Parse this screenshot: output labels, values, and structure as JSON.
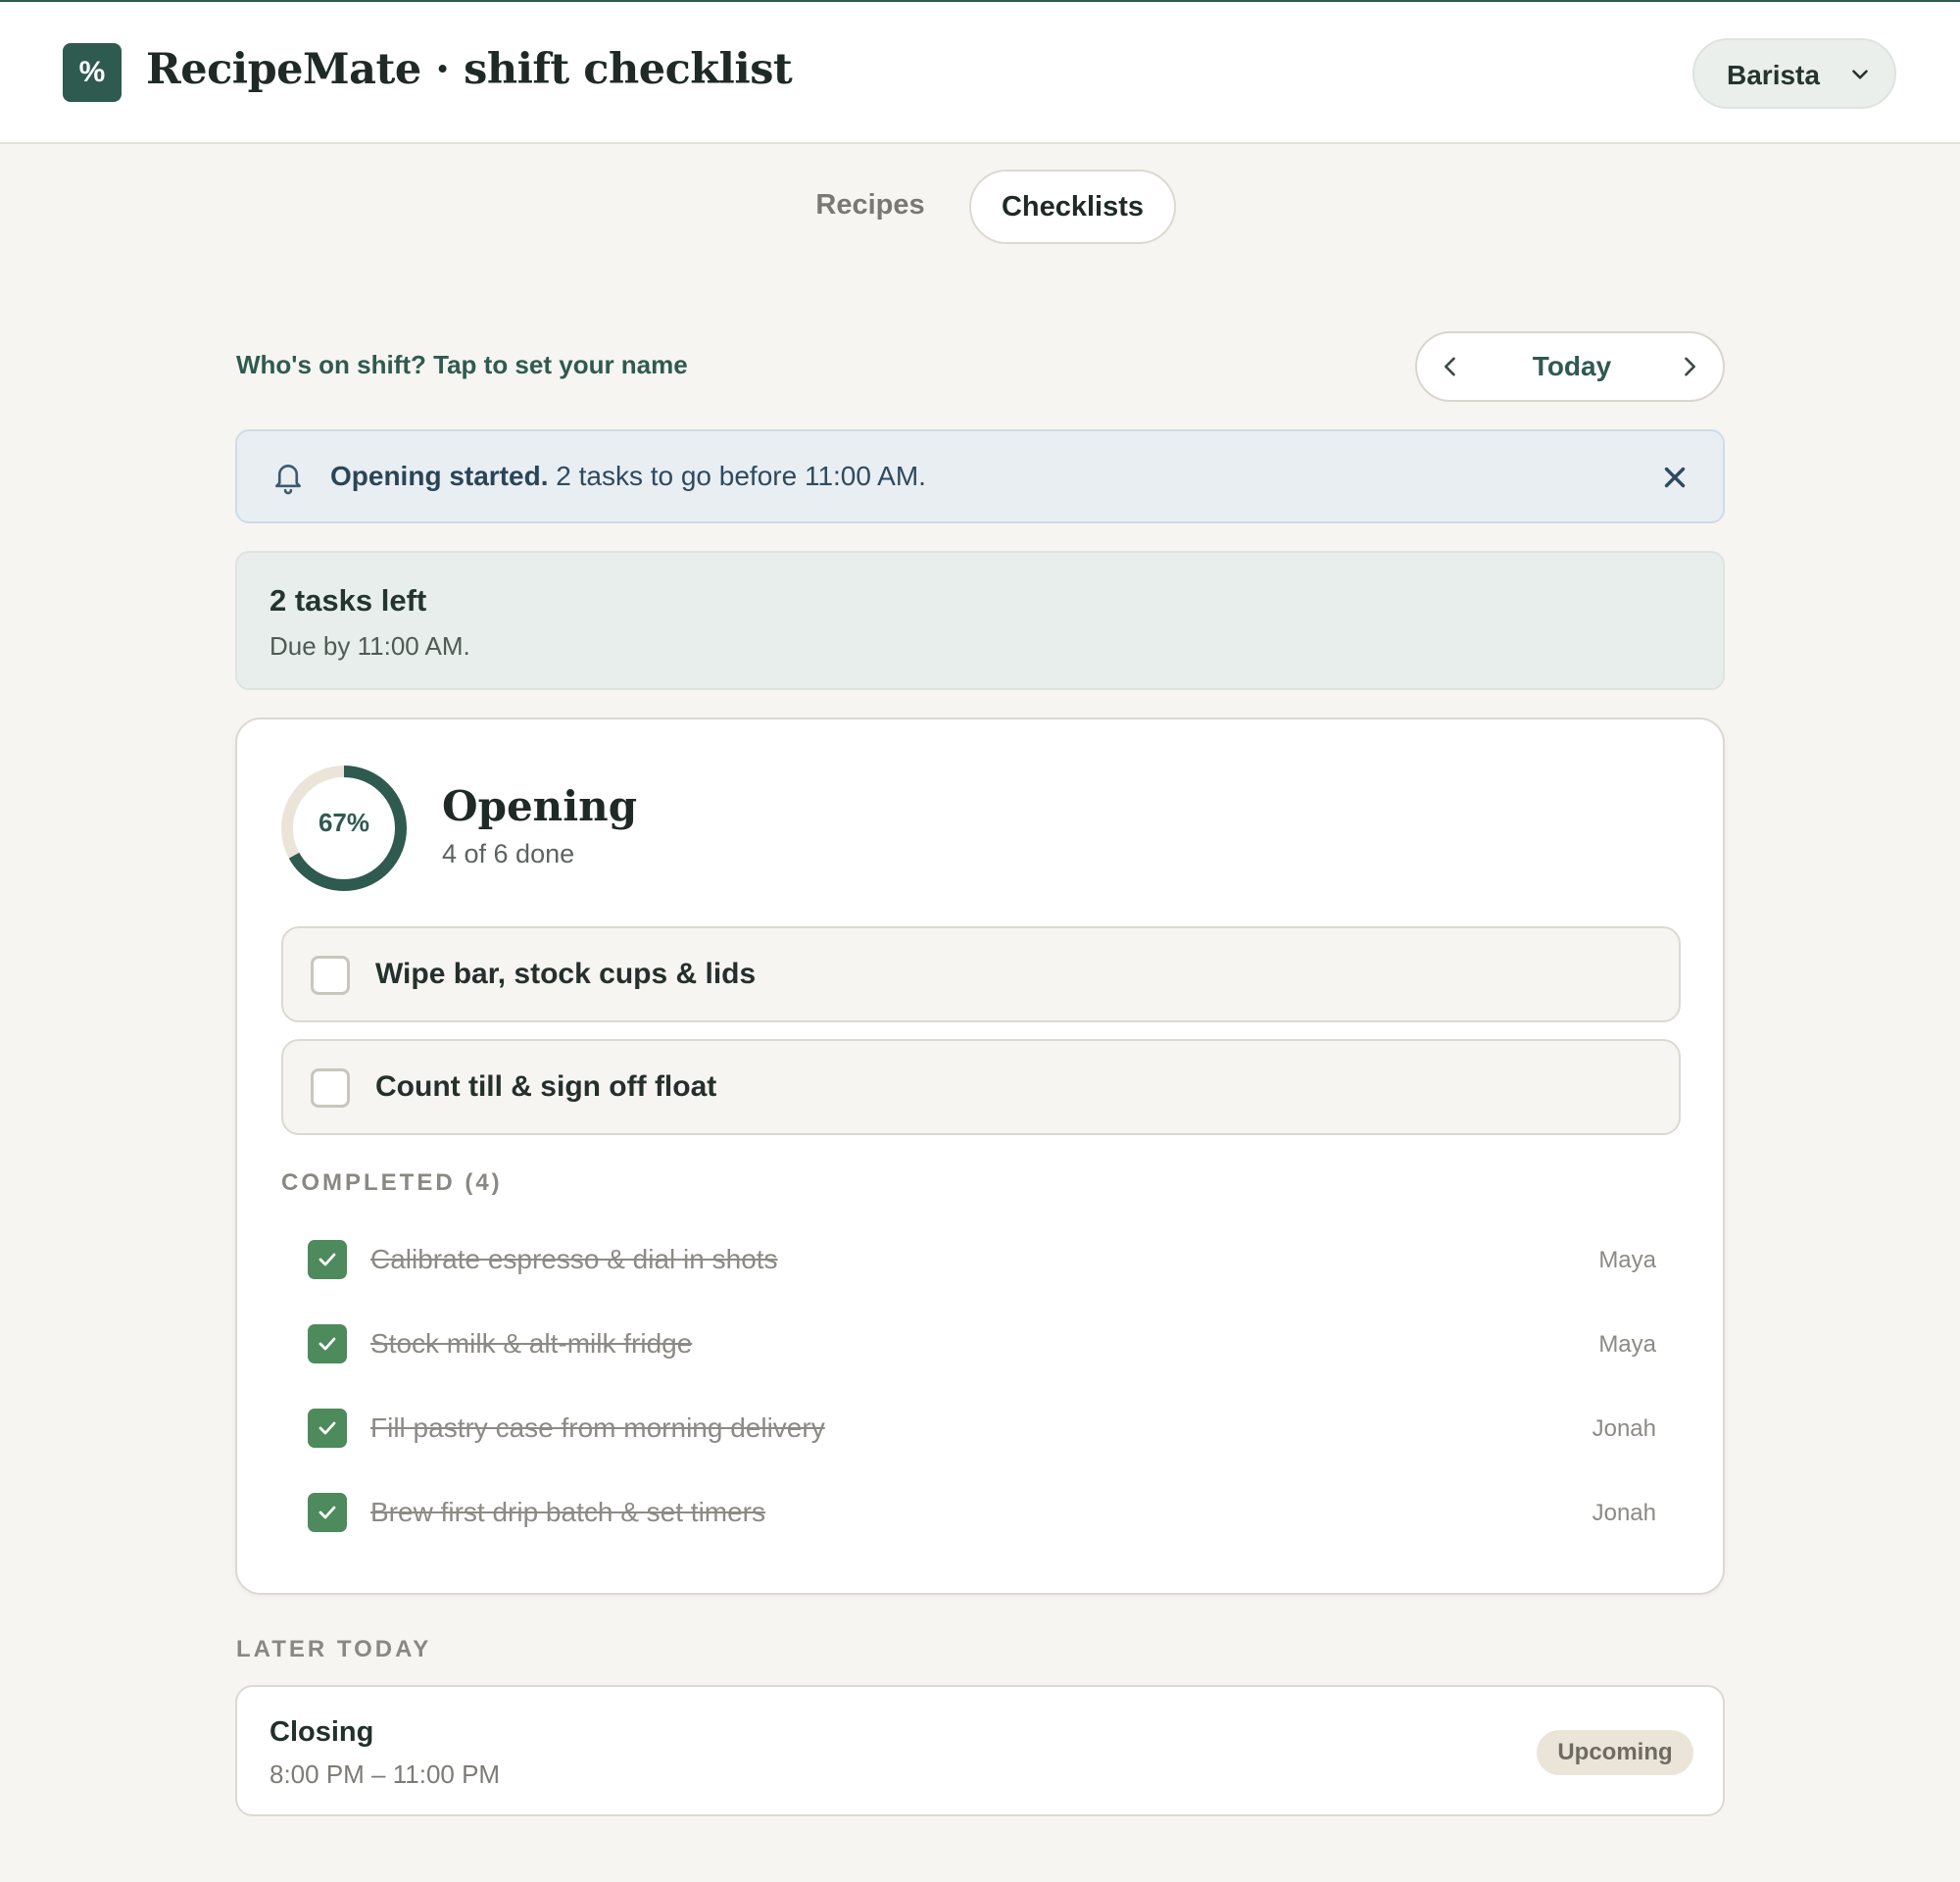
{
  "header": {
    "logo_glyph": "%",
    "title": "RecipeMate · shift checklist",
    "role_select": {
      "selected": "Barista"
    }
  },
  "tabs": [
    {
      "label": "Recipes",
      "active": false
    },
    {
      "label": "Checklists",
      "active": true
    }
  ],
  "shift": {
    "name_prompt": "Who's on shift? Tap to set your name"
  },
  "date_nav": {
    "label": "Today"
  },
  "notice": {
    "bold": "Opening started.",
    "text": " 2 tasks to go before 11:00 AM."
  },
  "summary": {
    "title": "2 tasks left",
    "subtitle": "Due by 11:00 AM."
  },
  "checklist": {
    "progress_label": "67%",
    "progress_fraction": 0.67,
    "title": "Opening",
    "subtitle": "4 of 6 done",
    "pending": [
      {
        "label": "Wipe bar, stock cups & lids"
      },
      {
        "label": "Count till & sign off float"
      }
    ],
    "completed_heading": "COMPLETED (4)",
    "completed": [
      {
        "label": "Calibrate espresso & dial in shots",
        "by": "Maya"
      },
      {
        "label": "Stock milk & alt-milk fridge",
        "by": "Maya"
      },
      {
        "label": "Fill pastry case from morning delivery",
        "by": "Jonah"
      },
      {
        "label": "Brew first drip batch & set timers",
        "by": "Jonah"
      }
    ]
  },
  "later": {
    "heading": "LATER TODAY",
    "items": [
      {
        "title": "Closing",
        "time": "8:00 PM – 11:00 PM",
        "badge": "Upcoming"
      }
    ]
  },
  "colors": {
    "brand": "#2f5a4f",
    "done_check": "#4d8a5c",
    "notice_bg": "#e9eef3",
    "summary_bg": "#e8eeeb",
    "ring_track": "#ebe5d9"
  },
  "icons": [
    "logo-icon",
    "chevron-down-icon",
    "chevron-left-icon",
    "chevron-right-icon",
    "bell-icon",
    "close-icon",
    "checkbox-icon",
    "check-icon"
  ]
}
